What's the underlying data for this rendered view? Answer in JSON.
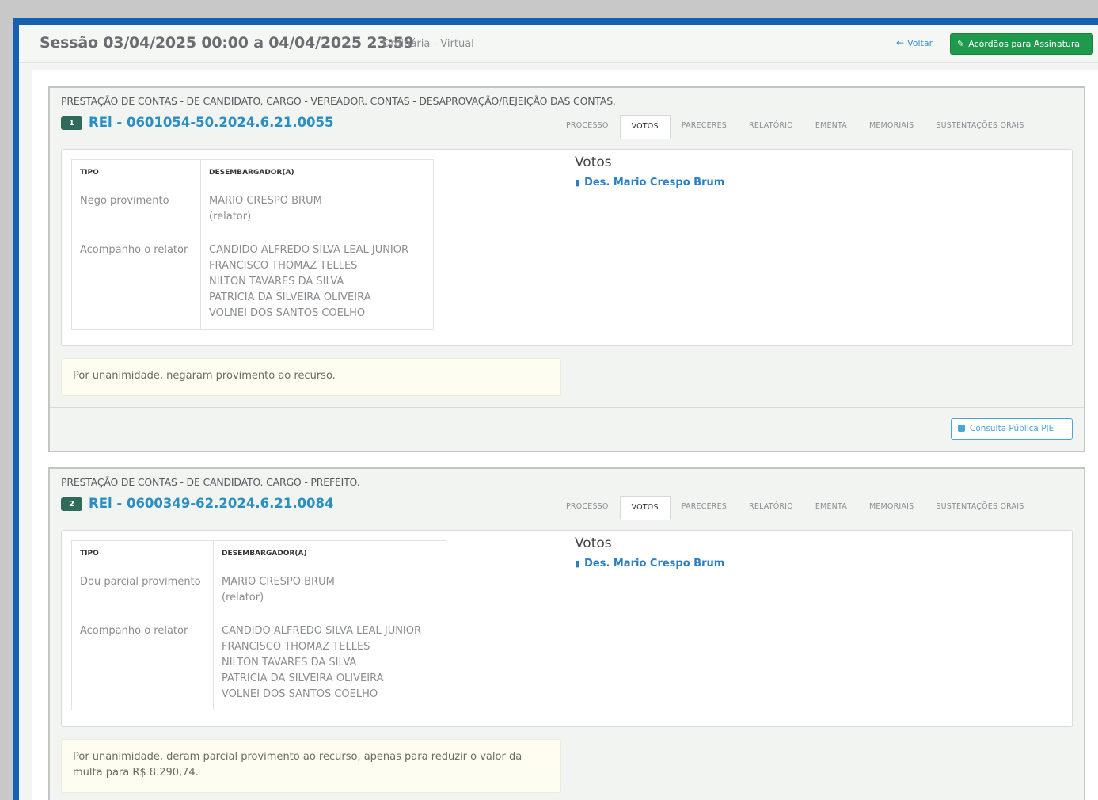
{
  "session": {
    "title": "Sessão 03/04/2025 00:00 a 04/04/2025 23:59",
    "subtitle": "Ordinária - Virtual"
  },
  "toolbar": {
    "back_label": "Voltar",
    "sign_label": "Acórdãos para Assinatura"
  },
  "tabs": [
    "PROCESSO",
    "VOTOS",
    "PARECERES",
    "RELATÓRIO",
    "EMENTA",
    "MEMORIAIS",
    "SUSTENTAÇÕES ORAIS"
  ],
  "table_headers": {
    "tipo": "TIPO",
    "desembargador": "DESEMBARGADOR(A)"
  },
  "votos_title": "Votos",
  "footer": {
    "consulta_label": "Consulta Pública PJE"
  },
  "processes": [
    {
      "badge": "1",
      "classe": "PRESTAÇÃO DE CONTAS - DE CANDIDATO. CARGO - VEREADOR. CONTAS - DESAPROVAÇÃO/REJEIÇÃO DAS CONTAS.",
      "number": "REl - 0601054-50.2024.6.21.0055",
      "active_tab": "VOTOS",
      "votes": [
        {
          "tipo": "Nego provimento",
          "names": [
            "MARIO CRESPO BRUM",
            "(relator)"
          ]
        },
        {
          "tipo": "Acompanho o relator",
          "names": [
            "CANDIDO ALFREDO SILVA LEAL JUNIOR",
            "FRANCISCO THOMAZ TELLES",
            "NILTON TAVARES DA SILVA",
            "PATRICIA DA SILVEIRA OLIVEIRA",
            "VOLNEI DOS SANTOS COELHO"
          ]
        }
      ],
      "voto_link": "Des. Mario Crespo Brum",
      "result": "Por unanimidade, negaram provimento ao recurso."
    },
    {
      "badge": "2",
      "classe": "PRESTAÇÃO DE CONTAS - DE CANDIDATO. CARGO - PREFEITO.",
      "number": "REl - 0600349-62.2024.6.21.0084",
      "active_tab": "VOTOS",
      "votes": [
        {
          "tipo": "Dou parcial provimento",
          "names": [
            "MARIO CRESPO BRUM",
            "(relator)"
          ]
        },
        {
          "tipo": "Acompanho o relator",
          "names": [
            "CANDIDO ALFREDO SILVA LEAL JUNIOR",
            "FRANCISCO THOMAZ TELLES",
            "NILTON TAVARES DA SILVA",
            "PATRICIA DA SILVEIRA OLIVEIRA",
            "VOLNEI DOS SANTOS COELHO"
          ]
        }
      ],
      "voto_link": "Des. Mario Crespo Brum",
      "result": "Por unanimidade, deram parcial provimento ao recurso, apenas para reduzir o valor da multa para R$ 8.290,74."
    }
  ],
  "colors": {
    "accent": "#2a8fc0",
    "success": "#1f9a4c",
    "frame": "#1560b0"
  }
}
